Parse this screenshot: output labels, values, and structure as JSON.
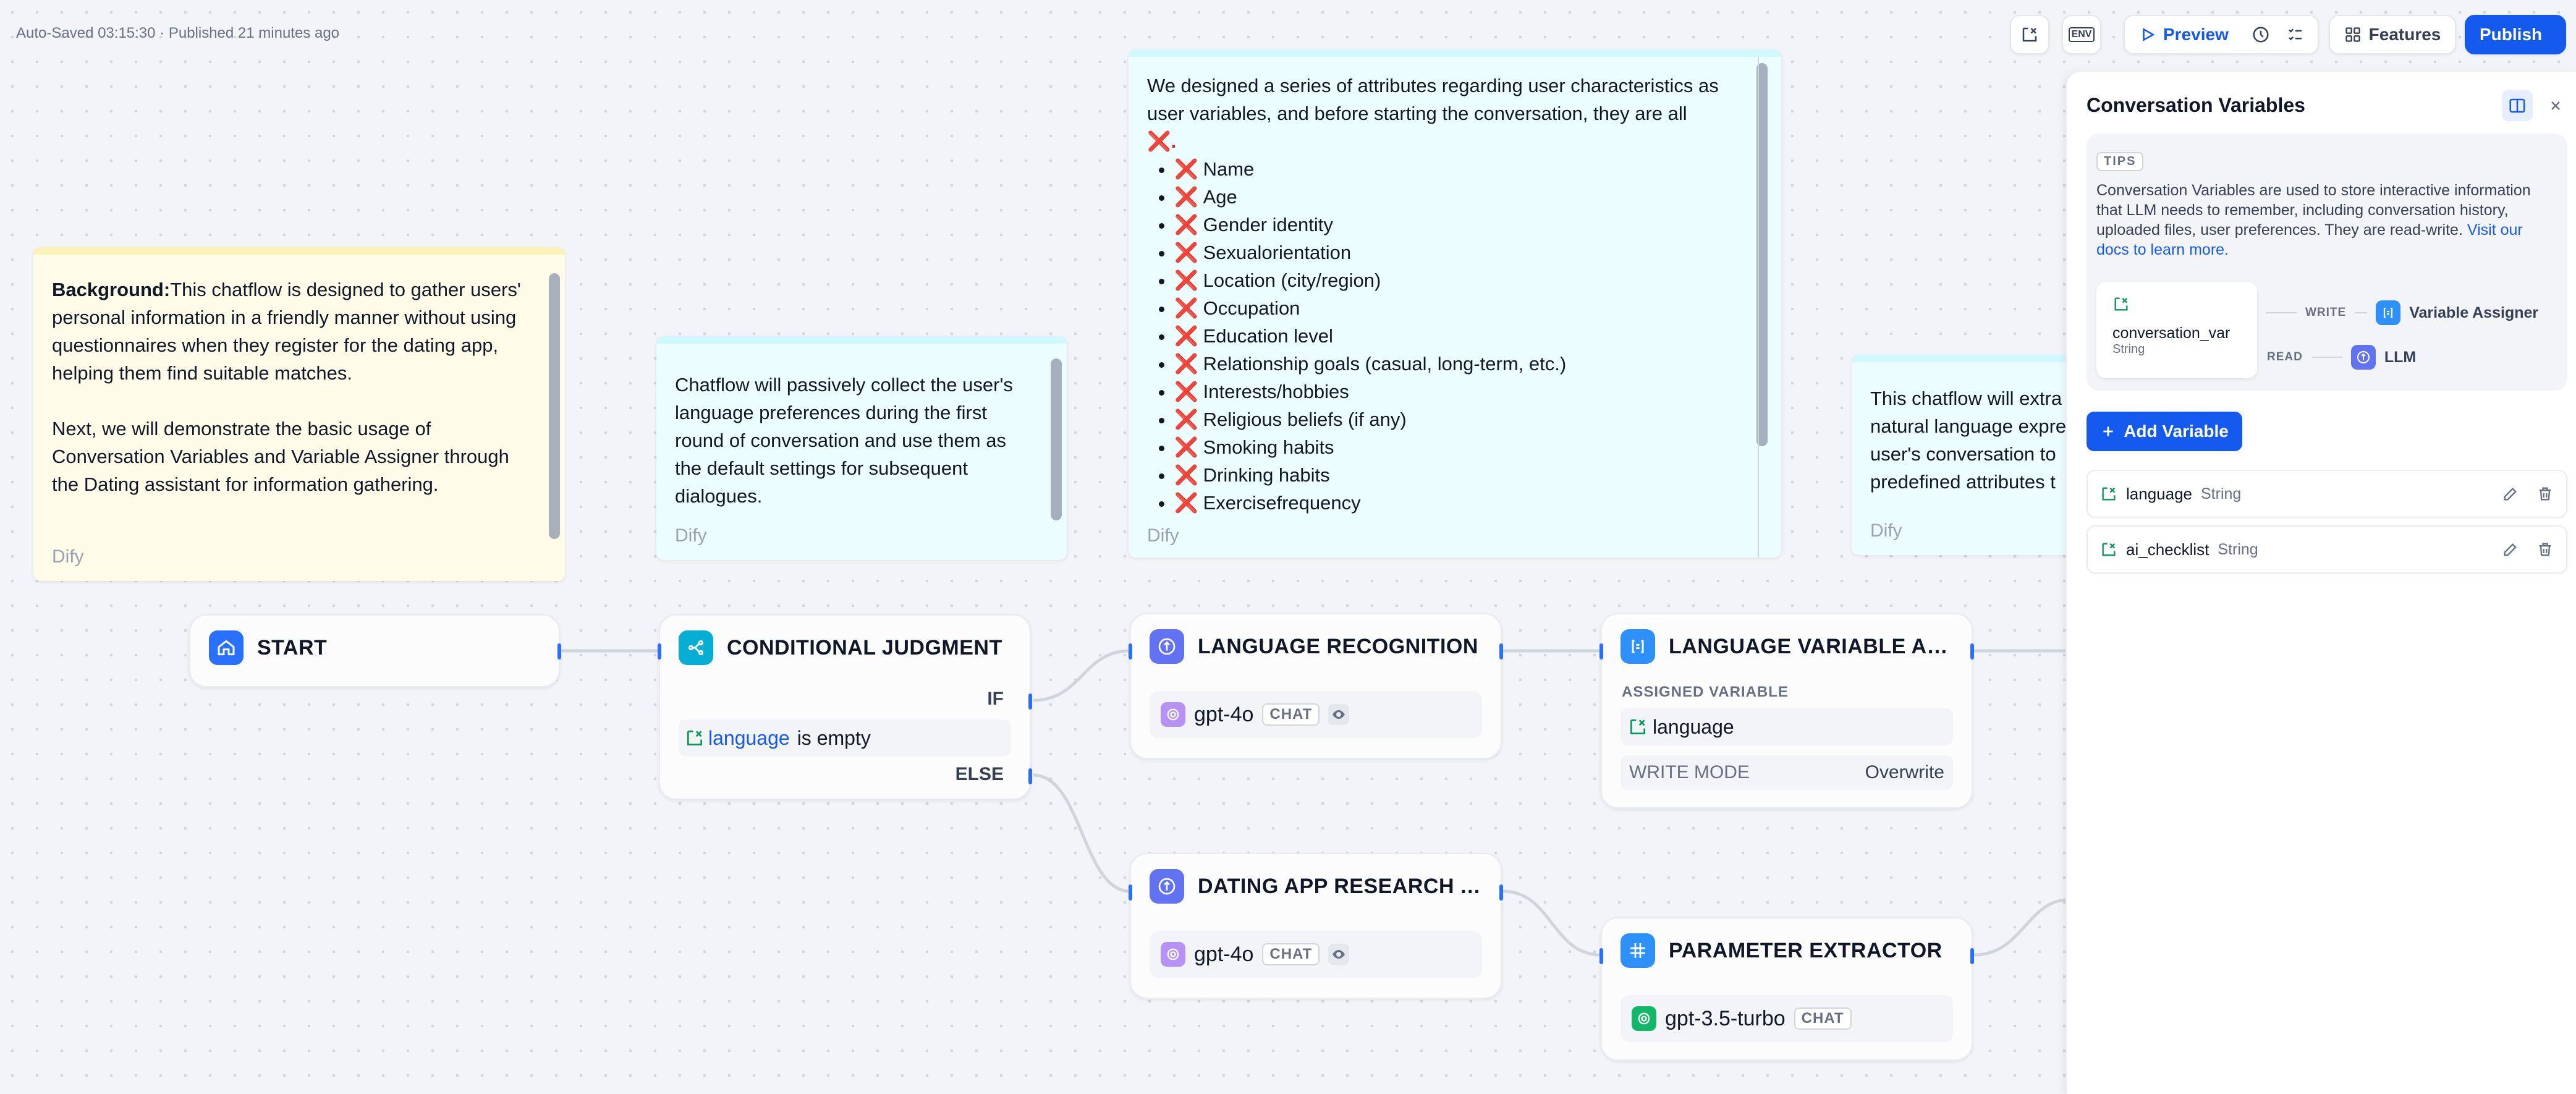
{
  "topbar": {
    "autosave_text": "Auto-Saved 03:15:30 · Published 21 minutes ago",
    "env_label": "ENV",
    "preview_label": "Preview",
    "features_label": "Features",
    "publish_label": "Publish"
  },
  "notes": {
    "background": {
      "bold": "Background:",
      "text1": "This chatflow is designed to gather users' personal information in a friendly manner without using questionnaires when they register for the dating app, helping them find suitable matches.",
      "text2": "Next, we will demonstrate the basic usage of Conversation Variables and Variable Assigner through the Dating assistant for information gathering.",
      "footer": "Dify"
    },
    "language": {
      "text": "Chatflow will passively collect the user's language preferences during the first round of conversation and use them as the default settings for subsequent dialogues.",
      "footer": "Dify"
    },
    "attributes": {
      "intro": "We designed a series of attributes regarding user characteristics as user variables, and before starting the conversation, they are all",
      "intro_mark": "❌.",
      "items": [
        "Name",
        "Age",
        "Gender identity",
        "Sexualorientation",
        "Location (city/region)",
        "Occupation",
        "Education level",
        "Relationship goals (casual, long-term, etc.)",
        "Interests/hobbies",
        "Religious beliefs (if any)",
        "Smoking habits",
        "Drinking habits",
        "Exercisefrequency"
      ],
      "footer": "Dify"
    },
    "extract": {
      "lines": [
        "This chatflow will extra",
        "natural language expre",
        "user's conversation to",
        "predefined attributes t"
      ],
      "footer": "Dify"
    }
  },
  "nodes": {
    "start": {
      "title": "START"
    },
    "conditional": {
      "title": "CONDITIONAL JUDGMENT",
      "if_label": "IF",
      "else_label": "ELSE",
      "condition_var": "language",
      "condition_op": "is empty"
    },
    "language_recognition": {
      "title": "LANGUAGE RECOGNITION",
      "model": "gpt-4o",
      "badge": "CHAT"
    },
    "language_assigner": {
      "title": "LANGUAGE VARIABLE AS...",
      "assigned_label": "ASSIGNED VARIABLE",
      "assigned_var": "language",
      "write_mode_label": "WRITE MODE",
      "write_mode_value": "Overwrite"
    },
    "dating_research": {
      "title": "DATING APP RESEARCH A...",
      "model": "gpt-4o",
      "badge": "CHAT"
    },
    "parameter_extractor": {
      "title": "PARAMETER EXTRACTOR",
      "model": "gpt-3.5-turbo",
      "badge": "CHAT"
    }
  },
  "panel": {
    "title": "Conversation Variables",
    "tips_label": "TIPS",
    "tips_text": "Conversation Variables are used to store interactive information that LLM needs to remember, including conversation history, uploaded files, user preferences. They are read-write.",
    "tips_link": "Visit our docs to learn more.",
    "card_name": "conversation_var",
    "card_type": "String",
    "write_label": "WRITE",
    "write_target": "Variable Assigner",
    "read_label": "READ",
    "read_target": "LLM",
    "add_button": "Add Variable",
    "variables": [
      {
        "name": "language",
        "type": "String"
      },
      {
        "name": "ai_checklist",
        "type": "String"
      }
    ]
  },
  "colors": {
    "accent": "#155aef",
    "handle": "#2970ff",
    "note_yellow": "#fefbe8",
    "note_cyan": "#ecfdff",
    "xmark": "#e02424"
  }
}
